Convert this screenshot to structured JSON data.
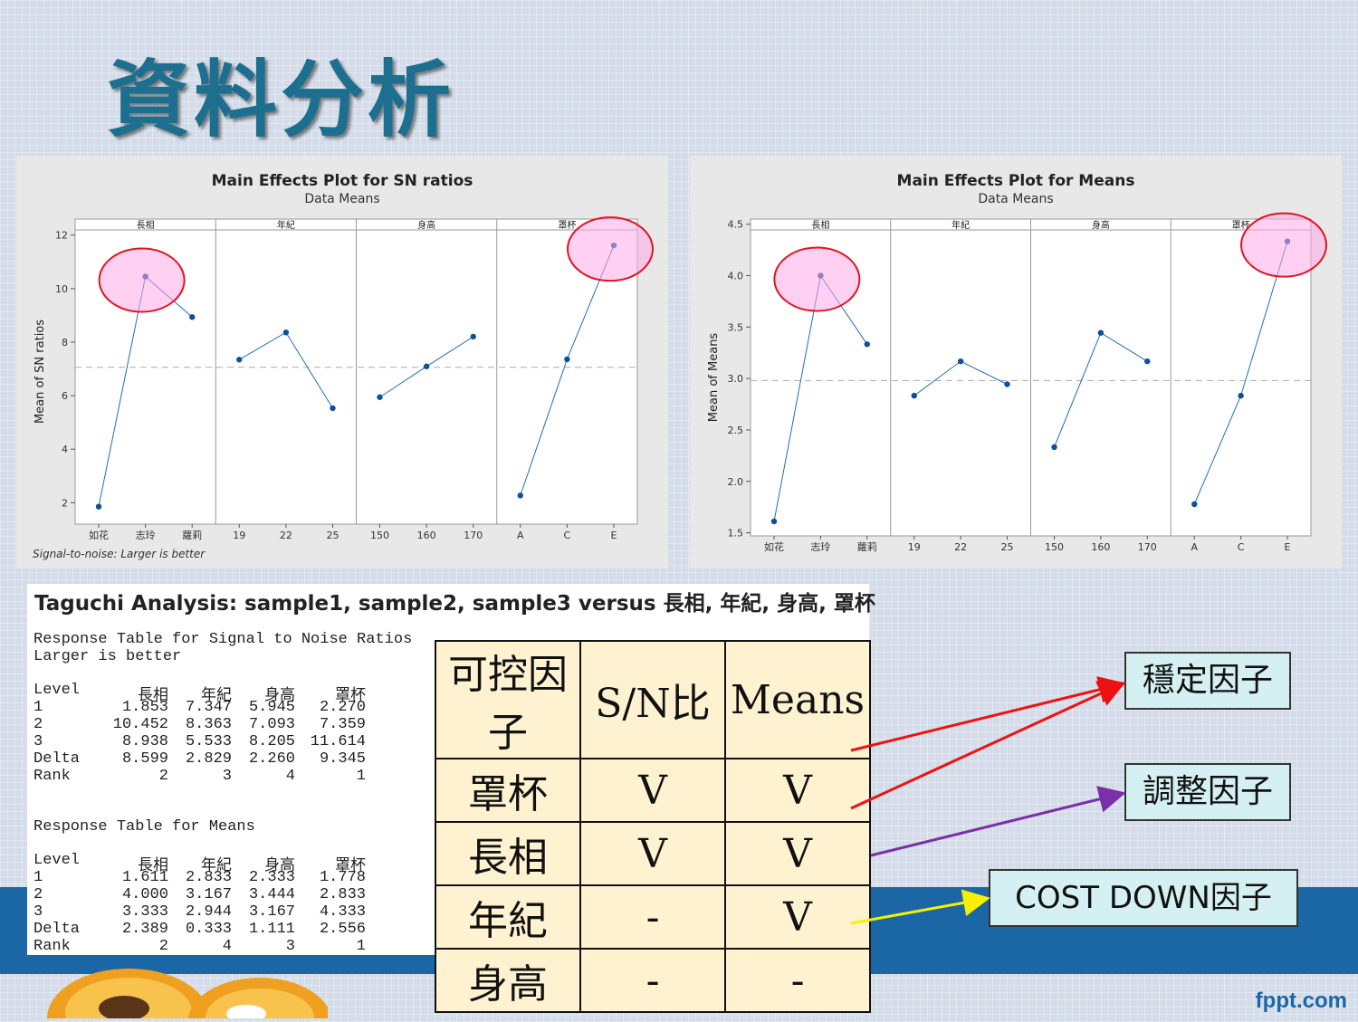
{
  "slide_title": "資料分析",
  "brand": "fppt.com",
  "chart_data": [
    {
      "type": "line",
      "title": "Main Effects Plot for SN ratios",
      "subtitle": "Data Means",
      "ylabel": "Mean of SN ratios",
      "ylim": [
        1.2,
        12.6
      ],
      "yticks": [
        2,
        4,
        6,
        8,
        10,
        12
      ],
      "reference_line": 7.06,
      "footnote": "Signal-to-noise: Larger is better",
      "panels": [
        {
          "name": "長相",
          "categories": [
            "如花",
            "志玲",
            "蘿莉"
          ],
          "values": [
            1.853,
            10.452,
            8.938
          ]
        },
        {
          "name": "年紀",
          "categories": [
            "19",
            "22",
            "25"
          ],
          "values": [
            7.347,
            8.363,
            5.533
          ]
        },
        {
          "name": "身高",
          "categories": [
            "150",
            "160",
            "170"
          ],
          "values": [
            5.945,
            7.093,
            8.205
          ]
        },
        {
          "name": "罩杯",
          "categories": [
            "A",
            "C",
            "E"
          ],
          "values": [
            2.27,
            7.359,
            11.614
          ]
        }
      ],
      "highlighted": [
        [
          0,
          1
        ],
        [
          3,
          2
        ]
      ]
    },
    {
      "type": "line",
      "title": "Main Effects Plot for Means",
      "subtitle": "Data Means",
      "ylabel": "Mean of Means",
      "ylim": [
        1.47,
        4.55
      ],
      "yticks": [
        1.5,
        2.0,
        2.5,
        3.0,
        3.5,
        4.0,
        4.5
      ],
      "reference_line": 2.98,
      "footnote": "",
      "panels": [
        {
          "name": "長相",
          "categories": [
            "如花",
            "志玲",
            "蘿莉"
          ],
          "values": [
            1.611,
            4.0,
            3.333
          ]
        },
        {
          "name": "年紀",
          "categories": [
            "19",
            "22",
            "25"
          ],
          "values": [
            2.833,
            3.167,
            2.944
          ]
        },
        {
          "name": "身高",
          "categories": [
            "150",
            "160",
            "170"
          ],
          "values": [
            2.333,
            3.444,
            3.167
          ]
        },
        {
          "name": "罩杯",
          "categories": [
            "A",
            "C",
            "E"
          ],
          "values": [
            1.778,
            2.833,
            4.333
          ]
        }
      ],
      "highlighted": [
        [
          0,
          1
        ],
        [
          3,
          2
        ]
      ]
    }
  ],
  "taguchi": {
    "title": "Taguchi Analysis: sample1, sample2, sample3 versus 長相, 年紀, 身高, 罩杯",
    "sn_heading": "Response Table for Signal to Noise Ratios",
    "sn_subheading": "Larger is better",
    "means_heading": "Response Table for Means",
    "columns": [
      "Level",
      "長相",
      "年紀",
      "身高",
      "罩杯"
    ],
    "sn_rows": [
      [
        "1",
        "1.853",
        "7.347",
        "5.945",
        "2.270"
      ],
      [
        "2",
        "10.452",
        "8.363",
        "7.093",
        "7.359"
      ],
      [
        "3",
        "8.938",
        "5.533",
        "8.205",
        "11.614"
      ],
      [
        "Delta",
        "8.599",
        "2.829",
        "2.260",
        "9.345"
      ],
      [
        "Rank",
        "2",
        "3",
        "4",
        "1"
      ]
    ],
    "means_rows": [
      [
        "1",
        "1.611",
        "2.833",
        "2.333",
        "1.778"
      ],
      [
        "2",
        "4.000",
        "3.167",
        "3.444",
        "2.833"
      ],
      [
        "3",
        "3.333",
        "2.944",
        "3.167",
        "4.333"
      ],
      [
        "Delta",
        "2.389",
        "0.333",
        "1.111",
        "2.556"
      ],
      [
        "Rank",
        "2",
        "4",
        "3",
        "1"
      ]
    ]
  },
  "factor_table": {
    "headers": [
      "可控因子",
      "S/N比",
      "Means"
    ],
    "rows": [
      [
        "罩杯",
        "V",
        "V"
      ],
      [
        "長相",
        "V",
        "V"
      ],
      [
        "年紀",
        "-",
        "V"
      ],
      [
        "身高",
        "-",
        "-"
      ]
    ]
  },
  "labels": {
    "stable": "穩定因子",
    "adjust": "調整因子",
    "cost_down": "COST DOWN因子"
  },
  "colors": {
    "band": "#1b67a5",
    "title": "#1c6f8e",
    "series_line": "#1f6fb4",
    "highlight": "#e0141e",
    "arrow_stable": "#ee1111",
    "arrow_adjust": "#7b2fa8",
    "arrow_cost": "#f6f000"
  }
}
